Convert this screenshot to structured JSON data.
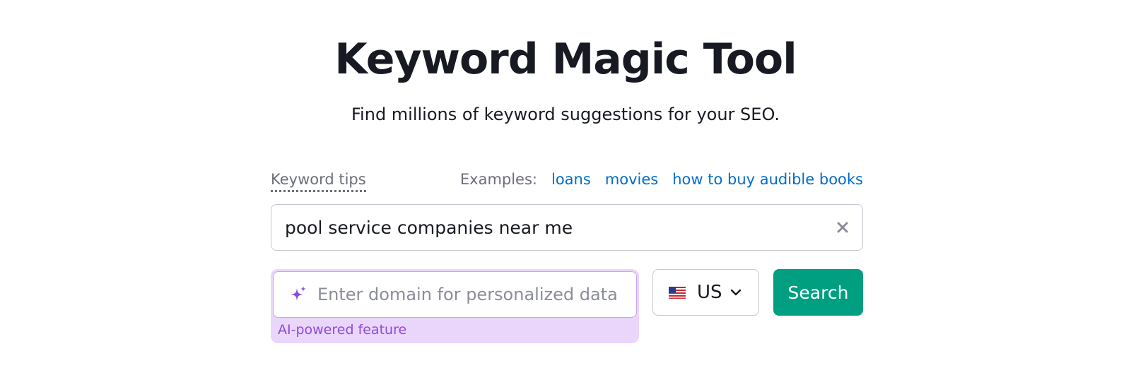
{
  "header": {
    "title": "Keyword Magic Tool",
    "subtitle": "Find millions of keyword suggestions for your SEO."
  },
  "tips": {
    "label": "Keyword tips"
  },
  "examples": {
    "label": "Examples:",
    "items": [
      "loans",
      "movies",
      "how to buy audible books"
    ]
  },
  "keyword_input": {
    "value": "pool service companies near me",
    "clear_icon": "close-icon"
  },
  "domain_input": {
    "placeholder": "Enter domain for personalized data",
    "value": "",
    "icon": "sparkle-icon",
    "note": "AI-powered feature"
  },
  "country_select": {
    "selected": "US",
    "flag_icon": "us-flag-icon",
    "dropdown_icon": "chevron-down-icon"
  },
  "search_button": {
    "label": "Search"
  },
  "colors": {
    "text": "#171a22",
    "muted": "#6c6e79",
    "link": "#006dca",
    "primary": "#009f81",
    "ai_accent": "#8d4bd8",
    "ai_background": "#ead6fb"
  }
}
